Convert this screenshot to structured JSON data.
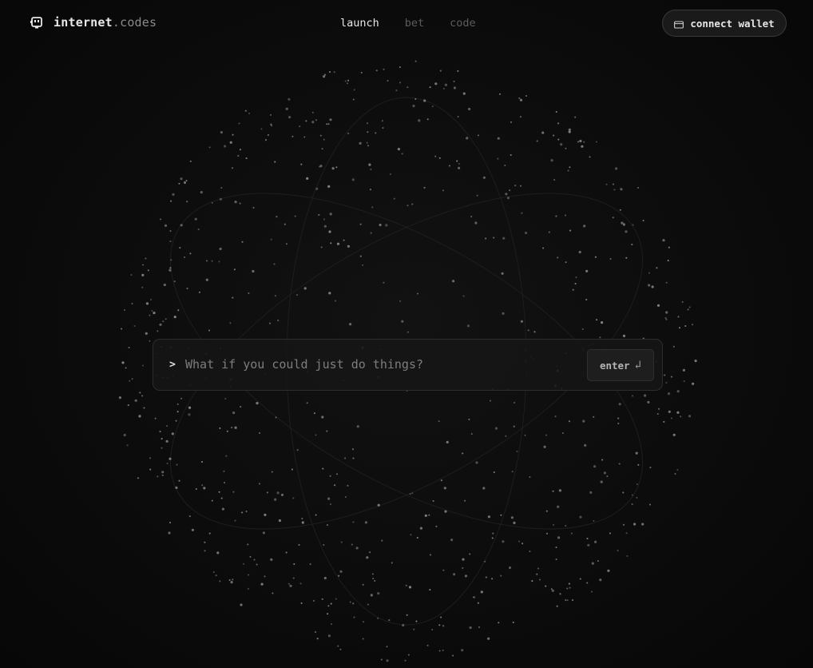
{
  "brand": {
    "name": "internet",
    "suffix": ".codes",
    "icon": "logo-face-icon"
  },
  "nav": {
    "items": [
      "launch",
      "bet",
      "code"
    ],
    "active": "launch"
  },
  "wallet": {
    "label": "connect wallet",
    "icon": "wallet-icon"
  },
  "prompt": {
    "symbol": ">",
    "placeholder": "What if you could just do things?",
    "value": "",
    "enter_label": "enter",
    "enter_icon": "↲"
  },
  "colors": {
    "background": "#0b0b0b",
    "accent": "#e6e6e6",
    "muted": "#5c5c5c",
    "dot": "#6a6a6a"
  }
}
